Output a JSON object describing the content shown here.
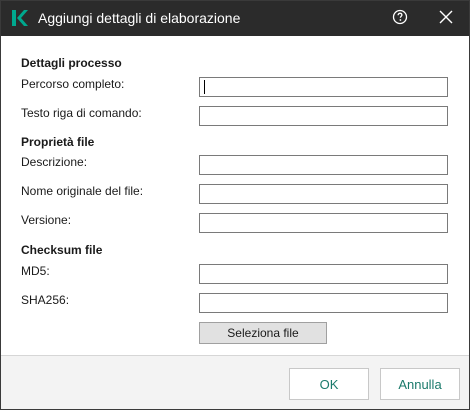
{
  "window": {
    "title": "Aggiungi dettagli di elaborazione",
    "logo_icon": "kaspersky-k-logo",
    "help_icon": "help-icon",
    "close_icon": "close-icon",
    "accent_color": "#00a88e"
  },
  "sections": {
    "process": {
      "title": "Dettagli processo",
      "full_path_label": "Percorso completo:",
      "full_path_value": "",
      "command_line_label": "Testo riga di comando:",
      "command_line_value": ""
    },
    "file_properties": {
      "title": "Proprietà file",
      "description_label": "Descrizione:",
      "description_value": "",
      "original_name_label": "Nome originale del file:",
      "original_name_value": "",
      "version_label": "Versione:",
      "version_value": ""
    },
    "checksum": {
      "title": "Checksum file",
      "md5_label": "MD5:",
      "md5_value": "",
      "sha256_label": "SHA256:",
      "sha256_value": "",
      "select_file_label": "Seleziona file"
    }
  },
  "footer": {
    "ok_label": "OK",
    "cancel_label": "Annulla"
  }
}
